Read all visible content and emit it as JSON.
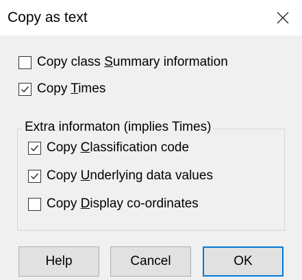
{
  "dialog": {
    "title": "Copy as text",
    "close_icon": "close-icon"
  },
  "options": {
    "summary": {
      "pre": "Copy class ",
      "key": "S",
      "post": "ummary information",
      "checked": false
    },
    "times": {
      "pre": "Copy ",
      "key": "T",
      "post": "imes",
      "checked": true
    }
  },
  "extra_group": {
    "label": "Extra informaton (implies Times)",
    "classification": {
      "pre": "Copy ",
      "key": "C",
      "post": "lassification code",
      "checked": true
    },
    "underlying": {
      "pre": "Copy ",
      "key": "U",
      "post": "nderlying data values",
      "checked": true
    },
    "display": {
      "pre": "Copy ",
      "key": "D",
      "post": "isplay co-ordinates",
      "checked": false
    }
  },
  "buttons": {
    "help": "Help",
    "cancel": "Cancel",
    "ok": "OK"
  }
}
